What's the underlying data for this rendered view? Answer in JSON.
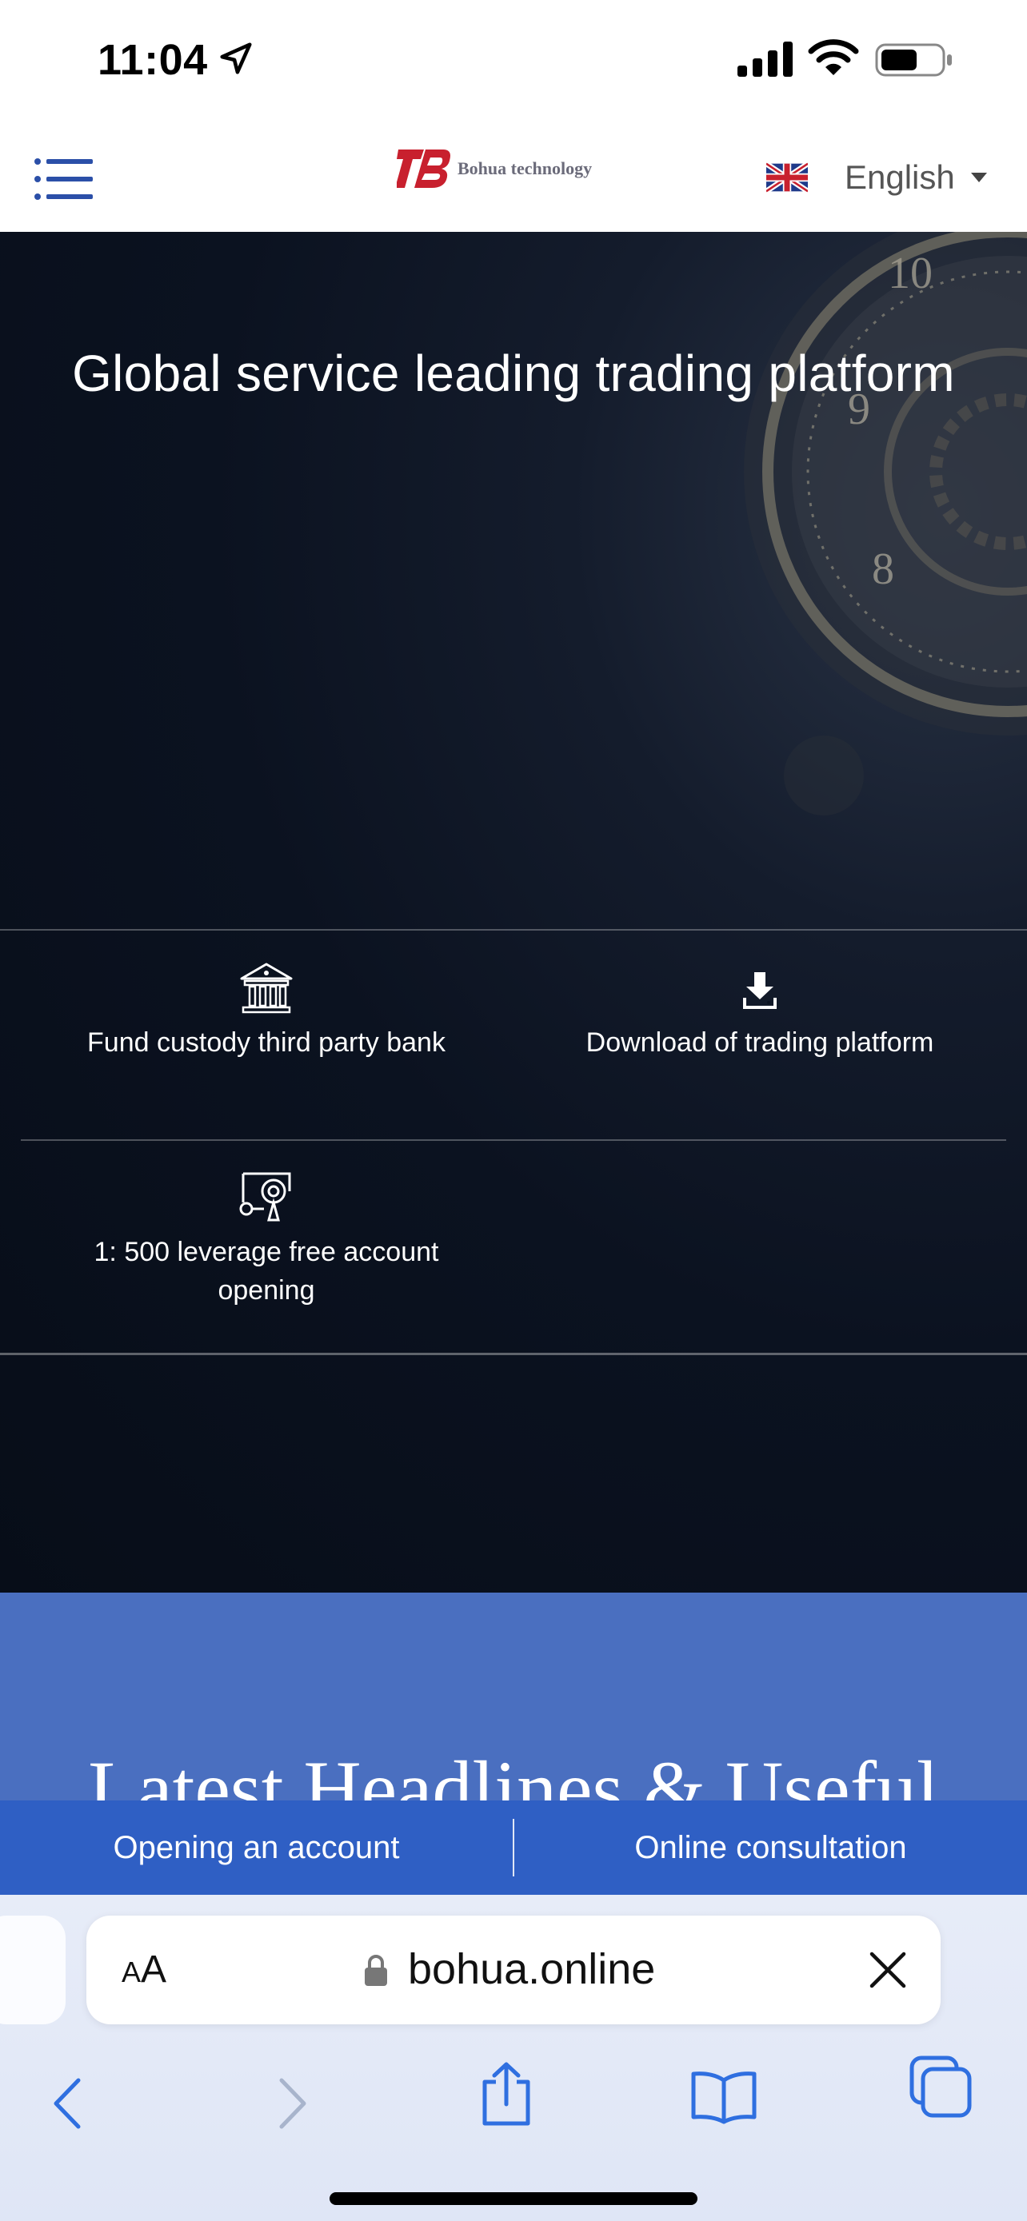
{
  "status_bar": {
    "time": "11:04"
  },
  "header": {
    "logo_text": "Bohua technology",
    "language": "English"
  },
  "hero": {
    "title": "Global service leading trading platform",
    "features": [
      {
        "label": "Fund custody third party bank",
        "icon": "bank-icon"
      },
      {
        "label": "Download of trading platform",
        "icon": "download-icon"
      },
      {
        "label": "1: 500 leverage free account opening",
        "icon": "leverage-icon"
      }
    ]
  },
  "headlines": {
    "title": "Latest Headlines & Useful"
  },
  "action_bar": {
    "open_account": "Opening an account",
    "consultation": "Online consultation"
  },
  "browser": {
    "aa_label_small": "A",
    "aa_label_big": "A",
    "url": "bohua.online"
  },
  "colors": {
    "hero_bg": "#0b1220",
    "headline_band": "#4a6fc0",
    "action_bar": "#2f5fc4",
    "logo_red": "#c8202e"
  }
}
